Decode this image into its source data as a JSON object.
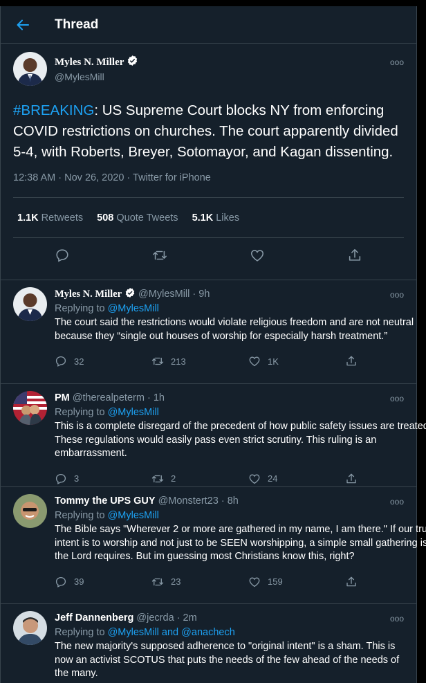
{
  "header": {
    "title": "Thread"
  },
  "main_tweet": {
    "author": "Myles N. Miller",
    "handle": "@MylesMill",
    "hashtag": "#BREAKING",
    "text": ": US Supreme Court blocks NY from enforcing COVID restrictions on churches. The court apparently divided 5-4, with Roberts, Breyer, Sotomayor, and Kagan dissenting.",
    "timestamp": "12:38 AM · Nov 26, 2020 · Twitter for iPhone",
    "retweets_count": "1.1K",
    "retweets_label": "Retweets",
    "quotes_count": "508",
    "quotes_label": "Quote Tweets",
    "likes_count": "5.1K",
    "likes_label": "Likes"
  },
  "replies": [
    {
      "author": "Myles N. Miller",
      "meta": "@MylesMill · 9h",
      "replying_prefix": "Replying to ",
      "replying_to": "@MylesMill",
      "text": "The court said the restrictions would violate religious freedom and are not neutral because they “single out houses of worship for especially harsh treatment.”",
      "replies": "32",
      "retweets": "213",
      "likes": "1K"
    },
    {
      "author": "PM",
      "meta": "@therealpeterm · 1h",
      "replying_prefix": "Replying to ",
      "replying_to": "@MylesMill",
      "text": "This is a complete disregard of the precedent of how public safety issues are treated. These regulations would easily pass even strict scrutiny. This ruling is an embarrassment.",
      "replies": "3",
      "retweets": "2",
      "likes": "24"
    },
    {
      "author": "Tommy the UPS GUY",
      "meta": "@Monstert23 · 8h",
      "replying_prefix": "Replying to ",
      "replying_to": "@MylesMill",
      "text": "The Bible says \"Wherever 2 or more are gathered in my name, I am there.\" If our true intent is to worship and not just to be SEEN worshipping, a simple small gathering is all the Lord requires. But im guessing most Christians know this, right?",
      "replies": "39",
      "retweets": "23",
      "likes": "159"
    },
    {
      "author": "Jeff Dannenberg",
      "meta": "@jecrda · 2m",
      "replying_prefix": "Replying to ",
      "replying_to": "@MylesMill and @anachech",
      "text": "The new majority's supposed adherence to \"original intent\" is a sham. This is now an activist SCOTUS that puts the needs of the few ahead of the needs of the many."
    }
  ],
  "more_glyph": "ooo",
  "colors": {
    "background": "#15202b",
    "accent": "#1da1f2",
    "muted": "#8899a6",
    "border": "#38444d"
  }
}
